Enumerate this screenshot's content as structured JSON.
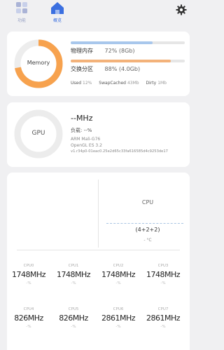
{
  "nav": {
    "tools_label": "功能",
    "overview_label": "概览"
  },
  "colors": {
    "accent_blue": "#3b6fe0",
    "memory_orange": "#f7a24e",
    "swap_orange": "#f3b27a",
    "physical_blue": "#a8c7ec"
  },
  "memory": {
    "ring_label": "Memory",
    "used_fraction": 0.72,
    "physical": {
      "label": "物理内存",
      "value": "72% (8Gb)",
      "fraction": 0.72
    },
    "swap": {
      "label": "交换分区",
      "value": "88% (4.0Gb)",
      "fraction": 0.88
    },
    "stats": [
      {
        "key": "Used",
        "value": "12%"
      },
      {
        "key": "SwapCached",
        "value": "43Mb"
      },
      {
        "key": "Dirty",
        "value": "1Mb"
      }
    ]
  },
  "gpu": {
    "ring_label": "GPU",
    "freq": "--MHz",
    "load": "负载: --%",
    "model": "ARM Mali-G76",
    "opengl": "OpenGL ES 3.2",
    "driver": "v1.r34p0-01eac0.25e2d65c33fa616585d4c9253de17"
  },
  "cpu": {
    "title": "CPU",
    "cores_layout": "(4+2+2)",
    "temp": "- °C",
    "cores": [
      {
        "name": "CPU0",
        "freq": "1748MHz",
        "load": "-%"
      },
      {
        "name": "CPU1",
        "freq": "1748MHz",
        "load": "-%"
      },
      {
        "name": "CPU2",
        "freq": "1748MHz",
        "load": "-%"
      },
      {
        "name": "CPU3",
        "freq": "1748MHz",
        "load": "-%"
      },
      {
        "name": "CPU4",
        "freq": "826MHz",
        "load": "-%"
      },
      {
        "name": "CPU5",
        "freq": "826MHz",
        "load": "-%"
      },
      {
        "name": "CPU6",
        "freq": "2861MHz",
        "load": "-%"
      },
      {
        "name": "CPU7",
        "freq": "2861MHz",
        "load": "-%"
      }
    ]
  }
}
